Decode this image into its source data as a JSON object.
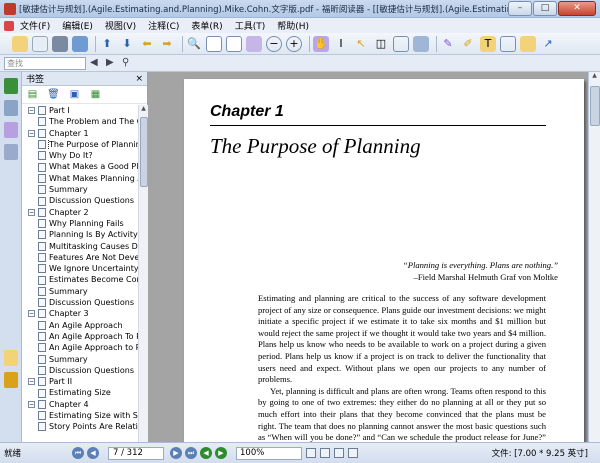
{
  "window": {
    "title": "[敏捷估计与规划].(Agile.Estimating.and.Planning).Mike.Cohn.文字版.pdf - 福昕阅读器 - [[敏捷估计与规划].(Agile.Estimating.and.Planning).Mike...",
    "minimize": "–",
    "maximize": "□",
    "close": "✕"
  },
  "menu": [
    "文件(F)",
    "编辑(E)",
    "视图(V)",
    "注释(C)",
    "表单(R)",
    "工具(T)",
    "帮助(H)"
  ],
  "subbar": {
    "search_placeholder": "查找"
  },
  "panel": {
    "title": "书签",
    "close": "×",
    "tree": [
      {
        "label": "Part I",
        "level": 0,
        "expander": "−"
      },
      {
        "label": "The Problem and The Goal",
        "level": 1
      },
      {
        "label": "Chapter 1",
        "level": 0,
        "expander": "−"
      },
      {
        "label": "The Purpose of Planning",
        "level": 1,
        "selected": true
      },
      {
        "label": "Why Do It?",
        "level": 1
      },
      {
        "label": "What Makes a Good Plan?",
        "level": 1
      },
      {
        "label": "What Makes Planning Agile?",
        "level": 1
      },
      {
        "label": "Summary",
        "level": 1
      },
      {
        "label": "Discussion Questions",
        "level": 1
      },
      {
        "label": "Chapter 2",
        "level": 0,
        "expander": "−"
      },
      {
        "label": "Why Planning Fails",
        "level": 1
      },
      {
        "label": "Planning Is By Activity",
        "level": 1
      },
      {
        "label": "Multitasking Causes Delays",
        "level": 1
      },
      {
        "label": "Features Are Not Developed",
        "level": 1
      },
      {
        "label": "We Ignore Uncertainty",
        "level": 1
      },
      {
        "label": "Estimates Become Commitments",
        "level": 1
      },
      {
        "label": "Summary",
        "level": 1
      },
      {
        "label": "Discussion Questions",
        "level": 1
      },
      {
        "label": "Chapter 3",
        "level": 0,
        "expander": "−"
      },
      {
        "label": "An Agile Approach",
        "level": 1
      },
      {
        "label": "An Agile Approach To Projects",
        "level": 1
      },
      {
        "label": "An Agile Approach to Planning",
        "level": 1
      },
      {
        "label": "Summary",
        "level": 1
      },
      {
        "label": "Discussion Questions",
        "level": 1
      },
      {
        "label": "Part II",
        "level": 0,
        "expander": "−"
      },
      {
        "label": "Estimating Size",
        "level": 1
      },
      {
        "label": "Chapter 4",
        "level": 0,
        "expander": "−"
      },
      {
        "label": "Estimating Size with Story Points",
        "level": 1
      },
      {
        "label": "Story Points Are Relative",
        "level": 1
      }
    ]
  },
  "page": {
    "chapter_label": "Chapter 1",
    "chapter_title": "The Purpose of Planning",
    "quote": "“Planning is everything. Plans are nothing.”",
    "quote_author": "–Field Marshal Helmuth Graf von Moltke",
    "paragraph1": "Estimating and planning are critical to the success of any software development project of any size or consequence. Plans guide our investment decisions: we might initiate a specific project if we estimate it to take six months and $1 million but would reject the same project if we thought it would take two years and $4 million. Plans help us know who needs to be available to work on a project during a given period. Plans help us know if a project is on track to deliver the functionality that users need and expect. Without plans we open our projects to any number of problems.",
    "paragraph2": "Yet, planning is difficult and plans are often wrong. Teams often respond to this by going to one of two extremes: they either do no planning at all or they put so much effort into their plans that they become convinced that the plans must be right. The team that does no planning cannot answer the most basic questions such as “When will you be done?” and “Can we schedule the product release for June?” The team that over-plans deludes themselves into thinking that any plan can be “right.” Their plan may be more thorough, but that does not necessarily mean it will be more accurate or useful."
  },
  "status": {
    "ready": "就绪",
    "page_indicator": "7 / 312",
    "zoom": "100%",
    "doc_size": "文件: [7.00 * 9.25 英寸]"
  }
}
